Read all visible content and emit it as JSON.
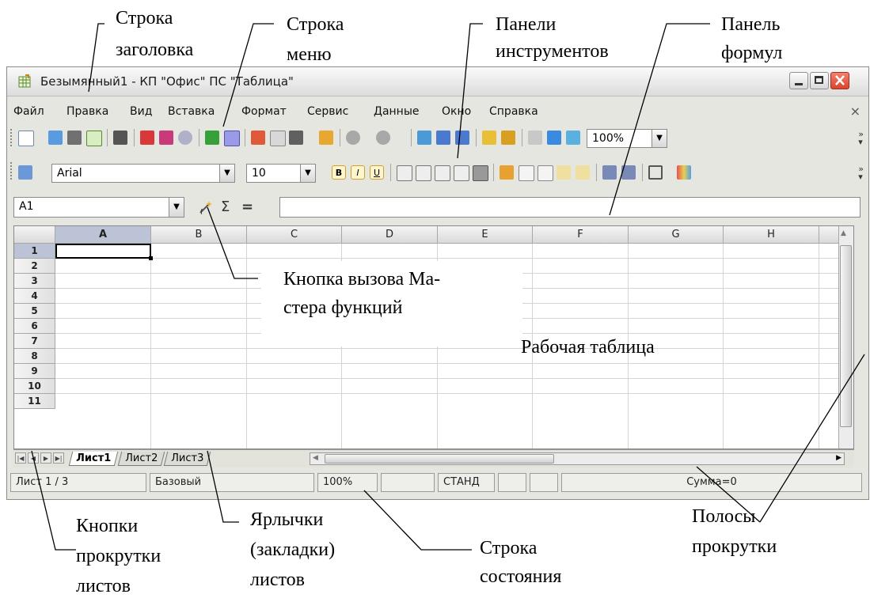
{
  "annotations": {
    "title_bar": "Строка\nзаголовка",
    "title_bar_l1": "Строка",
    "title_bar_l2": "заголовка",
    "menu_bar_l1": "Строка",
    "menu_bar_l2": "меню",
    "toolbars_l1": "Панели",
    "toolbars_l2": "инструментов",
    "formula_l1": "Панель",
    "formula_l2": "формул",
    "wizard_l1": "Кнопка вызова Ма-",
    "wizard_l2": "стера функций",
    "worksheet": "Рабочая таблица",
    "scroll_l1": "Кнопки",
    "scroll_l2": "прокрутки",
    "scroll_l3": "листов",
    "tabs_l1": "Ярлычки",
    "tabs_l2": "(закладки)",
    "tabs_l3": "листов",
    "status_l1": "Строка",
    "status_l2": "состояния",
    "scrollbars_l1": "Полосы",
    "scrollbars_l2": "прокрутки"
  },
  "window": {
    "title": "Безымянный1 - КП \"Офис\" ПС \"Таблица\""
  },
  "menu": {
    "items": [
      "Файл",
      "Правка",
      "Вид",
      "Вставка",
      "Формат",
      "Сервис",
      "Данные",
      "Окно",
      "Справка"
    ],
    "close": "×"
  },
  "toolbar": {
    "zoom": "100%"
  },
  "format_toolbar": {
    "font": "Arial",
    "size": "10"
  },
  "formula_bar": {
    "cell_ref": "A1",
    "sum_symbol": "Σ",
    "equals_symbol": "="
  },
  "sheet": {
    "columns": [
      "A",
      "B",
      "C",
      "D",
      "E",
      "F",
      "G",
      "H"
    ],
    "rows": [
      "1",
      "2",
      "3",
      "4",
      "5",
      "6",
      "7",
      "8",
      "9",
      "10",
      "11"
    ],
    "active_cell": "A1"
  },
  "tabs": [
    "Лист1",
    "Лист2",
    "Лист3"
  ],
  "status": {
    "sheet": "Лист 1 / 3",
    "style": "Базовый",
    "zoom": "100%",
    "mode": "СТАНД",
    "sum": "Сумма=0"
  },
  "colors": {
    "window_bg": "#e6e6e0",
    "close_button": "#d8442c",
    "active_header": "#bcc3d6"
  }
}
